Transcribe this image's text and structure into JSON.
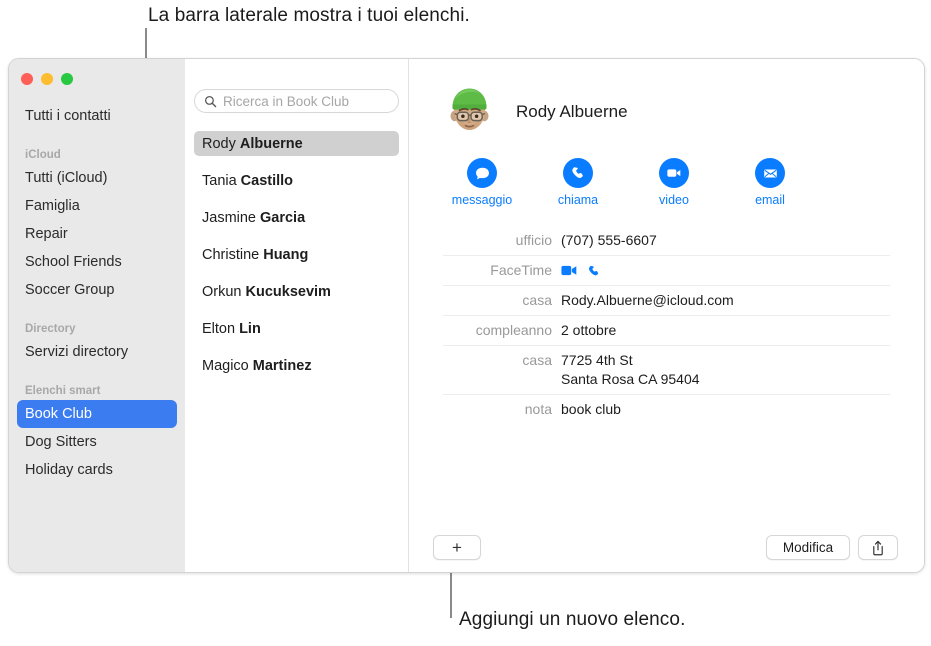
{
  "callouts": {
    "top": "La barra laterale mostra i tuoi elenchi.",
    "bottom": "Aggiungi un nuovo elenco."
  },
  "window": {
    "traffic_lights": [
      {
        "name": "close",
        "color": "#ff5f57"
      },
      {
        "name": "minimize",
        "color": "#febc2e"
      },
      {
        "name": "zoom",
        "color": "#28c840"
      }
    ]
  },
  "sidebar": {
    "all_contacts": "Tutti i contatti",
    "sections": [
      {
        "header": "iCloud",
        "items": [
          "Tutti (iCloud)",
          "Famiglia",
          "Repair",
          "School Friends",
          "Soccer Group"
        ]
      },
      {
        "header": "Directory",
        "items": [
          "Servizi directory"
        ]
      },
      {
        "header": "Elenchi smart",
        "items": [
          "Book Club",
          "Dog Sitters",
          "Holiday cards"
        ]
      }
    ],
    "selected": "Book Club",
    "selection_color": "#3b7df0"
  },
  "list_pane": {
    "search_placeholder": "Ricerca in Book Club",
    "contacts": [
      {
        "given": "Rody",
        "family": "Albuerne"
      },
      {
        "given": "Tania",
        "family": "Castillo"
      },
      {
        "given": "Jasmine",
        "family": "Garcia"
      },
      {
        "given": "Christine",
        "family": "Huang"
      },
      {
        "given": "Orkun",
        "family": "Kucuksevim"
      },
      {
        "given": "Elton",
        "family": "Lin"
      },
      {
        "given": "Magico",
        "family": "Martinez"
      }
    ],
    "selected_index": 0
  },
  "detail": {
    "name": "Rody Albuerne",
    "avatar_type": "memoji-green-beanie-glasses",
    "accent_color": "#0a7cff",
    "actions": [
      {
        "icon": "message-icon",
        "label": "messaggio"
      },
      {
        "icon": "phone-icon",
        "label": "chiama"
      },
      {
        "icon": "video-icon",
        "label": "video"
      },
      {
        "icon": "email-icon",
        "label": "email"
      }
    ],
    "fields": [
      {
        "label": "ufficio",
        "value": "(707) 555-6607",
        "type": "text"
      },
      {
        "label": "FaceTime",
        "value": "",
        "type": "icons"
      },
      {
        "label": "casa",
        "value": "Rody.Albuerne@icloud.com",
        "type": "text"
      },
      {
        "label": "compleanno",
        "value": "2 ottobre",
        "type": "text"
      },
      {
        "label": "casa",
        "value": "7725 4th St\nSanta Rosa CA 95404",
        "type": "text"
      },
      {
        "label": "nota",
        "value": "book club",
        "type": "text"
      }
    ]
  },
  "bottom_bar": {
    "add_label": "+",
    "edit_label": "Modifica",
    "share_icon": "share-icon"
  }
}
